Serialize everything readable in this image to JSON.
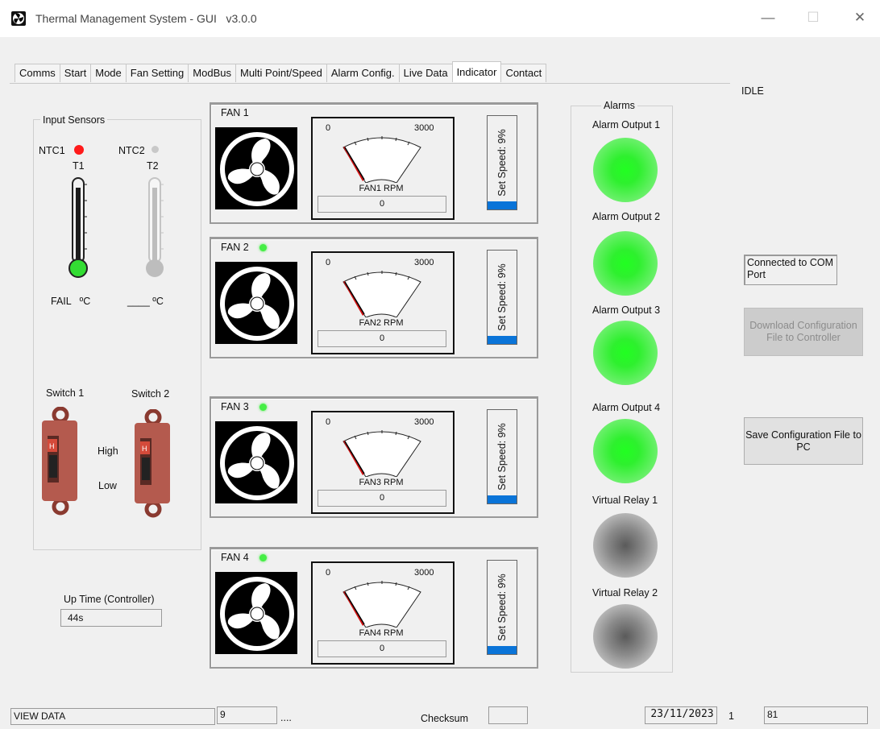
{
  "window": {
    "title": "Thermal Management System - GUI   v3.0.0",
    "minimize": "—",
    "maximize": "☐",
    "close": "✕"
  },
  "tabs": [
    "Comms",
    "Start",
    "Mode",
    "Fan Setting",
    "ModBus",
    "Multi Point/Speed",
    "Alarm Config.",
    "Live Data",
    "Indicator",
    "Contact"
  ],
  "active_tab": "Indicator",
  "status_idle": "IDLE",
  "sensors": {
    "group_label": "Input Sensors",
    "ntc1_label": "NTC1",
    "ntc2_label": "NTC2",
    "t1_label": "T1",
    "t2_label": "T2",
    "t1_value": "FAIL   ºC",
    "t2_value": "____ ºC",
    "ntc1_color": "#ff1a1a",
    "ntc2_color": "#c8c8c8"
  },
  "switches": {
    "switch1_label": "Switch 1",
    "switch2_label": "Switch 2",
    "high_label": "High",
    "low_label": "Low"
  },
  "uptime": {
    "label": "Up Time (Controller)",
    "value": "44s"
  },
  "fans": [
    {
      "label": "FAN 1",
      "led": "",
      "gauge_min": "0",
      "gauge_max": "3000",
      "rpm_label": "FAN1 RPM",
      "rpm": "0",
      "speed_text": "Set Speed: 9%",
      "speed_pct": 9
    },
    {
      "label": "FAN 2",
      "led": "#44ee44",
      "gauge_min": "0",
      "gauge_max": "3000",
      "rpm_label": "FAN2 RPM",
      "rpm": "0",
      "speed_text": "Set Speed: 9%",
      "speed_pct": 9
    },
    {
      "label": "FAN 3",
      "led": "#44ee44",
      "gauge_min": "0",
      "gauge_max": "3000",
      "rpm_label": "FAN3 RPM",
      "rpm": "0",
      "speed_text": "Set Speed: 9%",
      "speed_pct": 9
    },
    {
      "label": "FAN 4",
      "led": "#44ee44",
      "gauge_min": "0",
      "gauge_max": "3000",
      "rpm_label": "FAN4 RPM",
      "rpm": "0",
      "speed_text": "Set Speed: 9%",
      "speed_pct": 9
    }
  ],
  "alarms": {
    "group_label": "Alarms",
    "items": [
      {
        "label": "Alarm Output 1",
        "state": "on"
      },
      {
        "label": "Alarm Output 2",
        "state": "on"
      },
      {
        "label": "Alarm Output 3",
        "state": "on"
      },
      {
        "label": "Alarm Output 4",
        "state": "on"
      },
      {
        "label": "Virtual Relay 1",
        "state": "off"
      },
      {
        "label": "Virtual Relay 2",
        "state": "off"
      }
    ]
  },
  "right_panel": {
    "connection_status": "Connected to COM Port",
    "download_button": "Download Configuration File to Controller",
    "save_button": "Save Configuration File to PC"
  },
  "statusbar": {
    "mode": "VIEW DATA",
    "field2": "9",
    "dots": "....",
    "checksum_label": "Checksum",
    "checksum_value": "",
    "date": "23/11/2023",
    "field_a": "1",
    "field_b": "81"
  }
}
